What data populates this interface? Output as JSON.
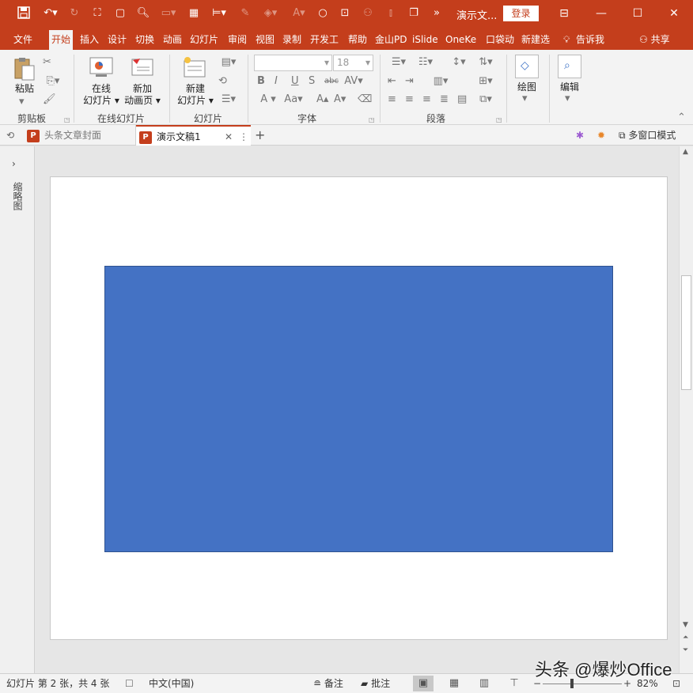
{
  "titlebar": {
    "doc_title": "演示文...",
    "login_label": "登录",
    "bg_color": "#c43e1c"
  },
  "qat": {
    "icons": [
      "save-icon",
      "undo-icon",
      "redo-icon",
      "slideshow-icon",
      "new-doc-icon",
      "print-preview-icon",
      "image-icon",
      "grid-icon",
      "align-icon",
      "pen-icon",
      "fill-icon",
      "font-color-icon",
      "shape-circle-icon",
      "select-icon",
      "person-icon",
      "distribute-icon",
      "arrange-icon",
      "more-icon"
    ]
  },
  "tabs": [
    "文件",
    "开始",
    "插入",
    "设计",
    "切换",
    "动画",
    "幻灯片",
    "审阅",
    "视图",
    "录制",
    "开发工",
    "帮助",
    "金山PD",
    "iSlide",
    "OneKe",
    "口袋动",
    "新建选"
  ],
  "tell_me": "告诉我",
  "share": "共享",
  "ribbon": {
    "clipboard": {
      "paste": "粘贴",
      "group": "剪贴板"
    },
    "online_slides": {
      "online_line1": "在线",
      "online_line2": "幻灯片",
      "new_anim_line1": "新加",
      "new_anim_line2": "动画页",
      "group": "在线幻灯片"
    },
    "slides": {
      "new_line1": "新建",
      "new_line2": "幻灯片",
      "group": "幻灯片"
    },
    "font": {
      "font_name": "",
      "font_size": "18",
      "group": "字体"
    },
    "paragraph": {
      "group": "段落"
    },
    "drawing": {
      "label": "绘图"
    },
    "editing": {
      "label": "编辑"
    }
  },
  "doctabs": {
    "tab1": "头条文章封面",
    "tab2": "演示文稿1",
    "multi_window": "多窗口模式"
  },
  "thumb_pane": {
    "label": "缩略图"
  },
  "slide": {
    "shape_color": "#4472c4"
  },
  "statusbar": {
    "slide_info": "幻灯片 第 2 张，共 4 张",
    "language": "中文(中国)",
    "notes": "备注",
    "comments": "批注",
    "zoom": "82%"
  },
  "watermark": "头条 @爆炒Office"
}
